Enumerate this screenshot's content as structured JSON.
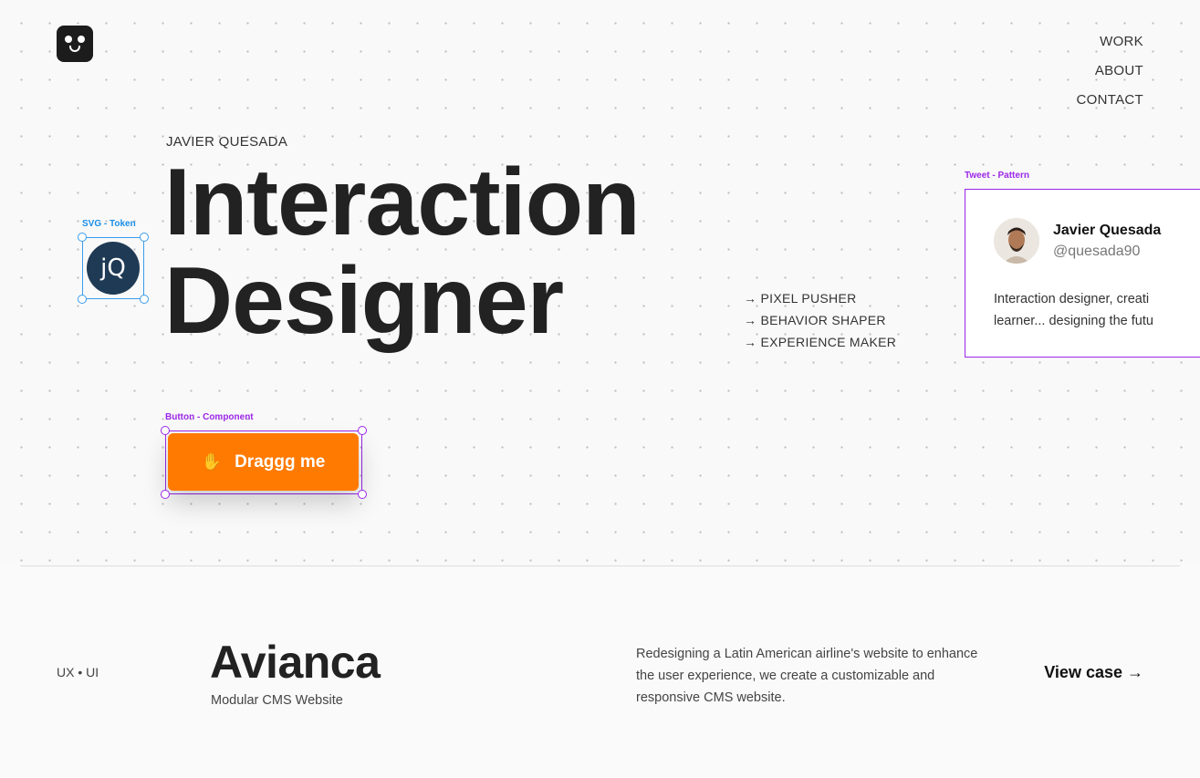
{
  "nav": {
    "items": [
      "WORK",
      "ABOUT",
      "CONTACT"
    ]
  },
  "hero": {
    "name_label": "JAVIER QUESADA",
    "headline_line1": "Interaction",
    "headline_line2": "Designer",
    "taglines": [
      "→ PIXEL PUSHER",
      "→ BEHAVIOR SHAPER",
      "→ EXPERIENCE MAKER"
    ]
  },
  "token": {
    "tag": "SVG - Token",
    "monogram": "jQ"
  },
  "button": {
    "tag": "Button - Component",
    "label": "Draggg me",
    "icon": "hand-icon",
    "color": "#ff7a00"
  },
  "tweet": {
    "tag": "Tweet - Pattern",
    "author": "Javier Quesada",
    "handle": "@quesada90",
    "text_line1": "Interaction designer, creati",
    "text_line2": "learner... designing the futu"
  },
  "case": {
    "meta": "UX • UI",
    "title": "Avianca",
    "subtitle": "Modular CMS Website",
    "description": "Redesigning a Latin American airline's website to enhance the user experience, we create a customizable and responsive CMS website.",
    "cta": "View case →"
  },
  "colors": {
    "accent": "#ff7a00",
    "selection_purple": "#9b27e8",
    "selection_blue": "#3a9bec"
  }
}
